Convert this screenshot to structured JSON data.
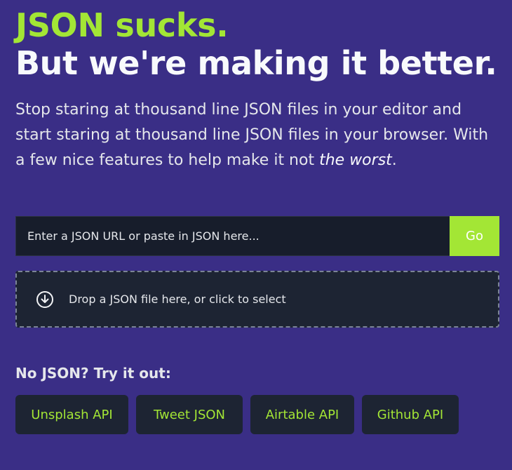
{
  "hero": {
    "headline_top": "JSON sucks.",
    "headline_main": "But we're making it better.",
    "description_part1": "Stop staring at thousand line JSON files in your editor and start staring at thousand line JSON files in your browser. With a few nice features to help make it not ",
    "description_emphasis": "the worst",
    "description_end": "."
  },
  "url_form": {
    "placeholder": "Enter a JSON URL or paste in JSON here...",
    "value": "",
    "button_label": "Go"
  },
  "dropzone": {
    "icon": "download-circle-icon",
    "text": "Drop a JSON file here, or click to select"
  },
  "examples": {
    "label": "No JSON? Try it out:",
    "items": [
      {
        "label": "Unsplash API"
      },
      {
        "label": "Tweet JSON"
      },
      {
        "label": "Airtable API"
      },
      {
        "label": "Github API"
      }
    ]
  },
  "colors": {
    "background": "#3a2e86",
    "accent": "#a3e635",
    "panel": "#1d2433"
  }
}
